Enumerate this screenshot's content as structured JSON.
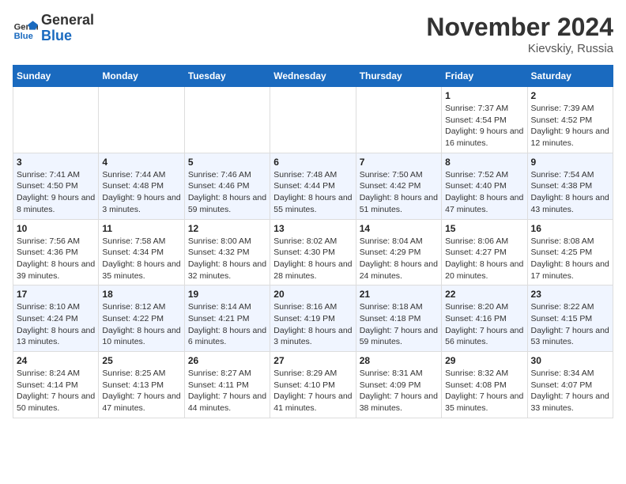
{
  "logo": {
    "text_general": "General",
    "text_blue": "Blue"
  },
  "title": "November 2024",
  "location": "Kievskiy, Russia",
  "days_of_week": [
    "Sunday",
    "Monday",
    "Tuesday",
    "Wednesday",
    "Thursday",
    "Friday",
    "Saturday"
  ],
  "weeks": [
    [
      {
        "day": "",
        "info": ""
      },
      {
        "day": "",
        "info": ""
      },
      {
        "day": "",
        "info": ""
      },
      {
        "day": "",
        "info": ""
      },
      {
        "day": "",
        "info": ""
      },
      {
        "day": "1",
        "info": "Sunrise: 7:37 AM\nSunset: 4:54 PM\nDaylight: 9 hours and 16 minutes."
      },
      {
        "day": "2",
        "info": "Sunrise: 7:39 AM\nSunset: 4:52 PM\nDaylight: 9 hours and 12 minutes."
      }
    ],
    [
      {
        "day": "3",
        "info": "Sunrise: 7:41 AM\nSunset: 4:50 PM\nDaylight: 9 hours and 8 minutes."
      },
      {
        "day": "4",
        "info": "Sunrise: 7:44 AM\nSunset: 4:48 PM\nDaylight: 9 hours and 3 minutes."
      },
      {
        "day": "5",
        "info": "Sunrise: 7:46 AM\nSunset: 4:46 PM\nDaylight: 8 hours and 59 minutes."
      },
      {
        "day": "6",
        "info": "Sunrise: 7:48 AM\nSunset: 4:44 PM\nDaylight: 8 hours and 55 minutes."
      },
      {
        "day": "7",
        "info": "Sunrise: 7:50 AM\nSunset: 4:42 PM\nDaylight: 8 hours and 51 minutes."
      },
      {
        "day": "8",
        "info": "Sunrise: 7:52 AM\nSunset: 4:40 PM\nDaylight: 8 hours and 47 minutes."
      },
      {
        "day": "9",
        "info": "Sunrise: 7:54 AM\nSunset: 4:38 PM\nDaylight: 8 hours and 43 minutes."
      }
    ],
    [
      {
        "day": "10",
        "info": "Sunrise: 7:56 AM\nSunset: 4:36 PM\nDaylight: 8 hours and 39 minutes."
      },
      {
        "day": "11",
        "info": "Sunrise: 7:58 AM\nSunset: 4:34 PM\nDaylight: 8 hours and 35 minutes."
      },
      {
        "day": "12",
        "info": "Sunrise: 8:00 AM\nSunset: 4:32 PM\nDaylight: 8 hours and 32 minutes."
      },
      {
        "day": "13",
        "info": "Sunrise: 8:02 AM\nSunset: 4:30 PM\nDaylight: 8 hours and 28 minutes."
      },
      {
        "day": "14",
        "info": "Sunrise: 8:04 AM\nSunset: 4:29 PM\nDaylight: 8 hours and 24 minutes."
      },
      {
        "day": "15",
        "info": "Sunrise: 8:06 AM\nSunset: 4:27 PM\nDaylight: 8 hours and 20 minutes."
      },
      {
        "day": "16",
        "info": "Sunrise: 8:08 AM\nSunset: 4:25 PM\nDaylight: 8 hours and 17 minutes."
      }
    ],
    [
      {
        "day": "17",
        "info": "Sunrise: 8:10 AM\nSunset: 4:24 PM\nDaylight: 8 hours and 13 minutes."
      },
      {
        "day": "18",
        "info": "Sunrise: 8:12 AM\nSunset: 4:22 PM\nDaylight: 8 hours and 10 minutes."
      },
      {
        "day": "19",
        "info": "Sunrise: 8:14 AM\nSunset: 4:21 PM\nDaylight: 8 hours and 6 minutes."
      },
      {
        "day": "20",
        "info": "Sunrise: 8:16 AM\nSunset: 4:19 PM\nDaylight: 8 hours and 3 minutes."
      },
      {
        "day": "21",
        "info": "Sunrise: 8:18 AM\nSunset: 4:18 PM\nDaylight: 7 hours and 59 minutes."
      },
      {
        "day": "22",
        "info": "Sunrise: 8:20 AM\nSunset: 4:16 PM\nDaylight: 7 hours and 56 minutes."
      },
      {
        "day": "23",
        "info": "Sunrise: 8:22 AM\nSunset: 4:15 PM\nDaylight: 7 hours and 53 minutes."
      }
    ],
    [
      {
        "day": "24",
        "info": "Sunrise: 8:24 AM\nSunset: 4:14 PM\nDaylight: 7 hours and 50 minutes."
      },
      {
        "day": "25",
        "info": "Sunrise: 8:25 AM\nSunset: 4:13 PM\nDaylight: 7 hours and 47 minutes."
      },
      {
        "day": "26",
        "info": "Sunrise: 8:27 AM\nSunset: 4:11 PM\nDaylight: 7 hours and 44 minutes."
      },
      {
        "day": "27",
        "info": "Sunrise: 8:29 AM\nSunset: 4:10 PM\nDaylight: 7 hours and 41 minutes."
      },
      {
        "day": "28",
        "info": "Sunrise: 8:31 AM\nSunset: 4:09 PM\nDaylight: 7 hours and 38 minutes."
      },
      {
        "day": "29",
        "info": "Sunrise: 8:32 AM\nSunset: 4:08 PM\nDaylight: 7 hours and 35 minutes."
      },
      {
        "day": "30",
        "info": "Sunrise: 8:34 AM\nSunset: 4:07 PM\nDaylight: 7 hours and 33 minutes."
      }
    ]
  ]
}
